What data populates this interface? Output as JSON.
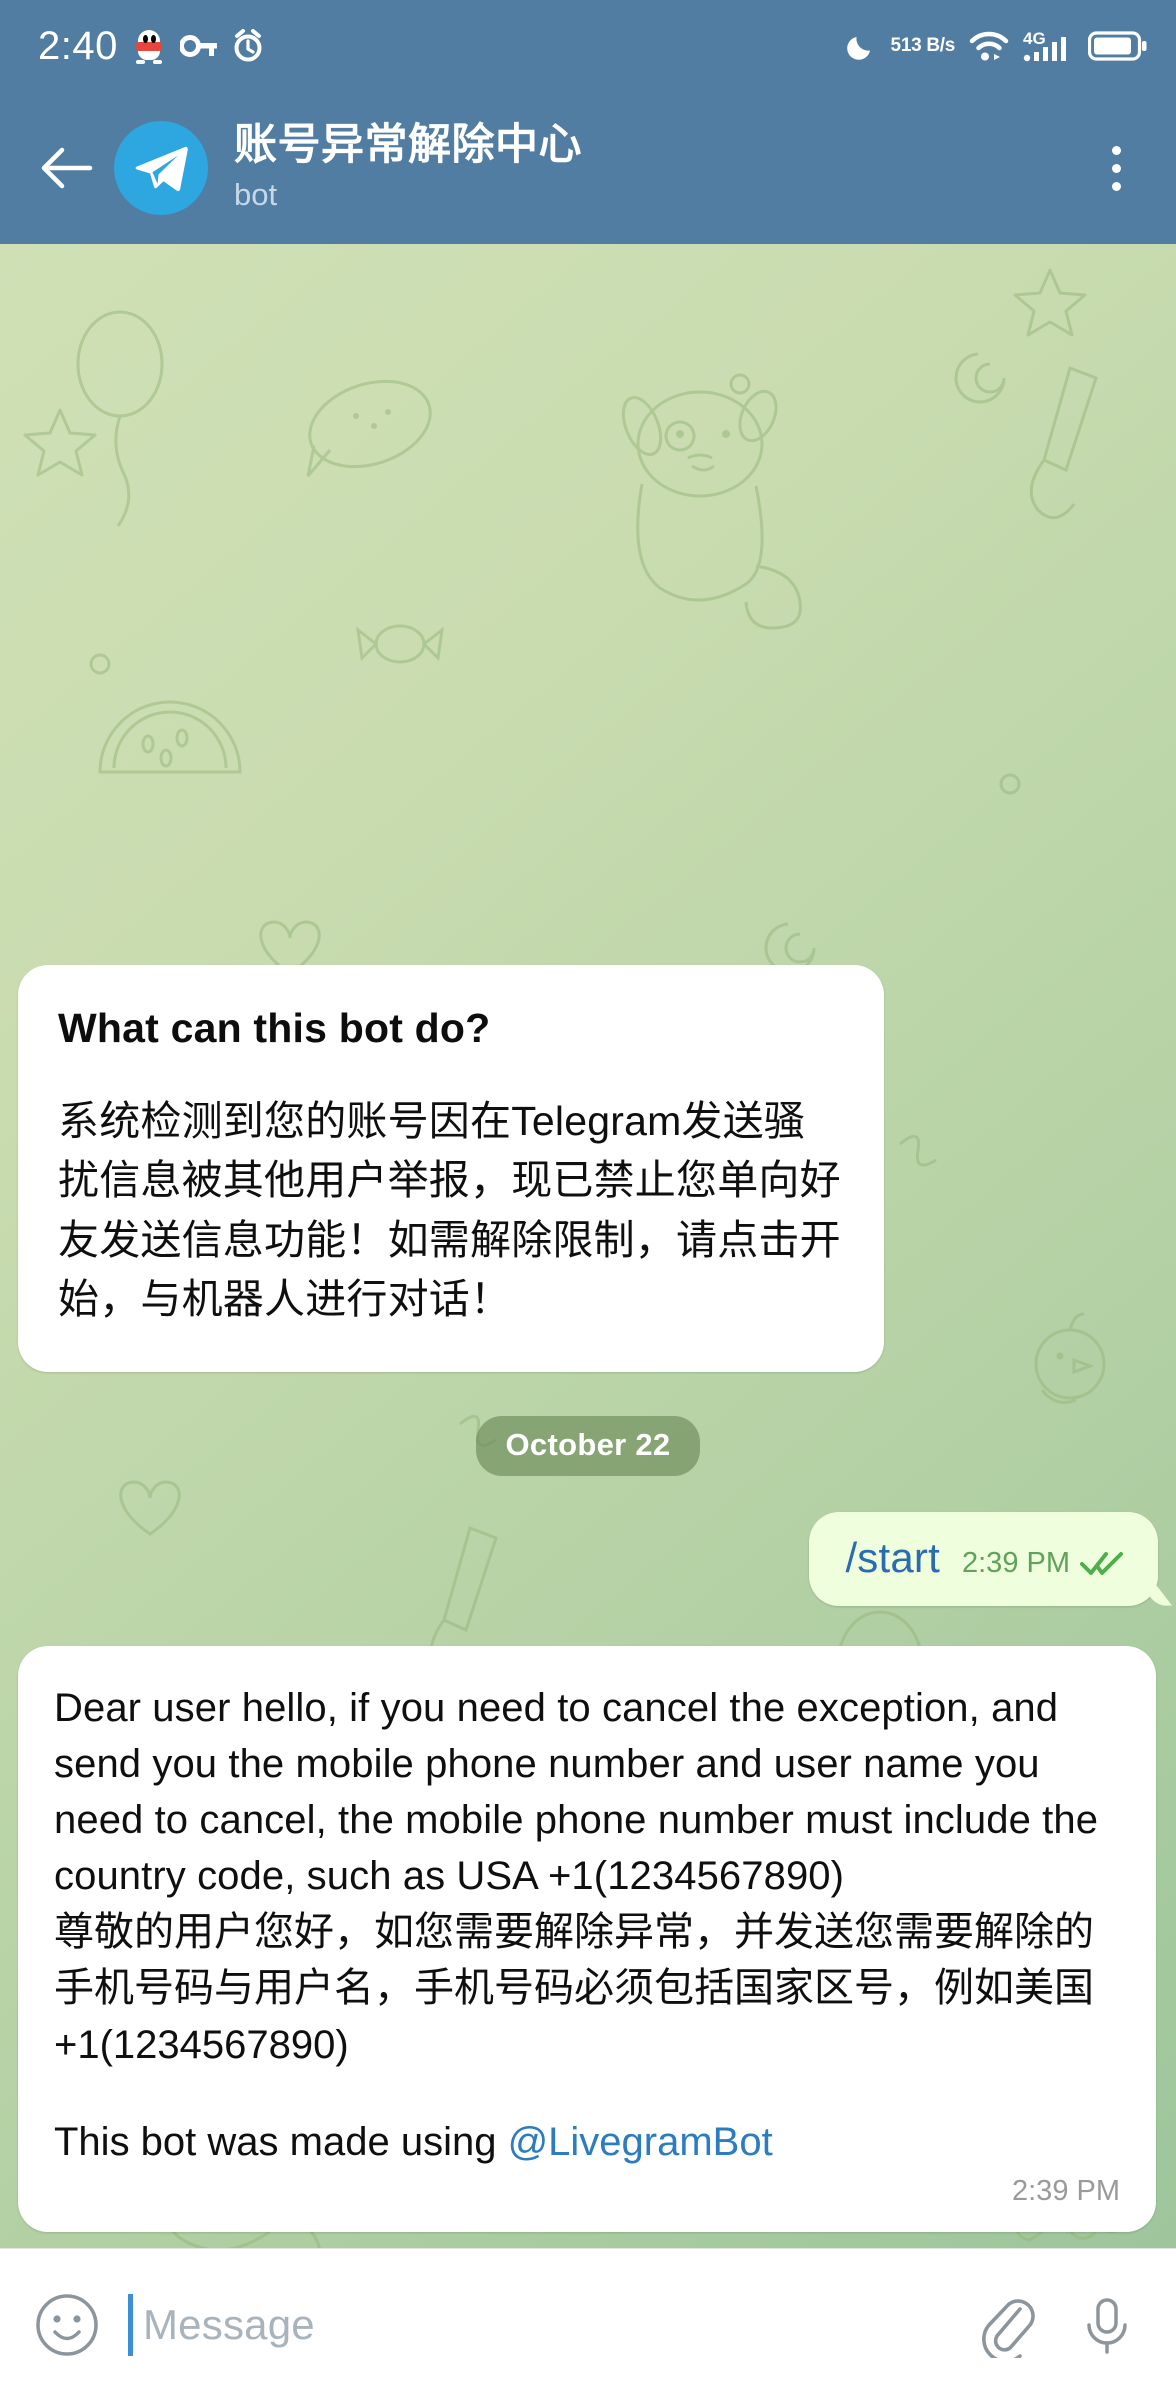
{
  "status_bar": {
    "time": "2:40",
    "network_speed": "513\nB/s",
    "icons": [
      "qq-penguin-icon",
      "vpn-key-icon",
      "alarm-clock-icon",
      "do-not-disturb-moon-icon",
      "wifi-icon",
      "signal-4g-icon",
      "battery-icon"
    ],
    "signal_label": "4G"
  },
  "header": {
    "back_label": "back-arrow",
    "title": "账号异常解除中心",
    "subtitle": "bot",
    "menu_label": "more-options",
    "bg_color": "#517DA2",
    "avatar_color": "#2EA6E0"
  },
  "messages": [
    {
      "id": "bot-intro",
      "direction": "incoming",
      "title": "What can this bot do?",
      "body": "系统检测到您的账号因在Telegram发送骚扰信息被其他用户举报，现已禁止您单向好友发送信息功能！如需解除限制，请点击开始，与机器人进行对话！"
    },
    {
      "id": "date-divider",
      "type": "date",
      "label": "October 22"
    },
    {
      "id": "user-start",
      "direction": "outgoing",
      "text": "/start",
      "time": "2:39 PM",
      "read_status": "double-check"
    },
    {
      "id": "bot-reply",
      "direction": "incoming",
      "text_en": "Dear user hello, if you need to cancel the exception, and send you the mobile phone number and user name you need to cancel, the mobile phone number must include the country code, such as USA +1(1234567890)",
      "text_cn": "尊敬的用户您好，如您需要解除异常，并发送您需要解除的手机号码与用户名，手机号码必须包括国家区号，例如美国\n+1(1234567890)",
      "footer_prefix": "This bot was made using ",
      "footer_mention": "@LivegramBot",
      "time": "2:39 PM"
    }
  ],
  "input_bar": {
    "placeholder": "Message",
    "value": "",
    "emoji_label": "emoji-picker",
    "attach_label": "attach-file",
    "mic_label": "voice-record"
  },
  "colors": {
    "header_blue": "#517DA2",
    "outgoing_bubble": "#EFFEDD",
    "incoming_bubble": "#FFFFFF",
    "command_link": "#2B6BB2",
    "mention_link": "#2B7CC0",
    "check_green": "#4FAE4E",
    "chat_bg_top": "#CFE0B5",
    "chat_bg_bottom": "#9EC59C"
  }
}
